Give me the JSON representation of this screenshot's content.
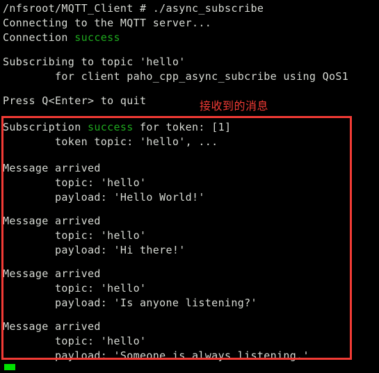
{
  "terminal": {
    "background_color": "#000000",
    "foreground_color": "#d8dbd5",
    "success_color": "#1faa1f",
    "cursor_color": "#00e000",
    "lines": [
      {
        "indent": 0,
        "text": "/nfsroot/MQTT_Client # ./async_subscribe"
      },
      {
        "indent": 0,
        "text": "Connecting to the MQTT server..."
      },
      {
        "indent": 0,
        "text": "Connection "
      },
      {
        "indent": 0,
        "text": ""
      },
      {
        "indent": 0,
        "text": "Subscribing to topic 'hello'"
      },
      {
        "indent": 8,
        "text": "for client paho_cpp_async_subcribe using QoS1"
      },
      {
        "indent": 0,
        "text": ""
      },
      {
        "indent": 0,
        "text": "Press Q<Enter> to quit"
      },
      {
        "indent": 0,
        "text": ""
      },
      {
        "indent": 0,
        "text": "Subscription "
      },
      {
        "indent": 8,
        "text": "token topic: 'hello', ..."
      },
      {
        "indent": 0,
        "text": ""
      },
      {
        "indent": 0,
        "text": "Message arrived"
      },
      {
        "indent": 8,
        "text": "topic: 'hello'"
      },
      {
        "indent": 8,
        "text": "payload: 'Hello World!'"
      },
      {
        "indent": 0,
        "text": ""
      },
      {
        "indent": 0,
        "text": "Message arrived"
      },
      {
        "indent": 8,
        "text": "topic: 'hello'"
      },
      {
        "indent": 8,
        "text": "payload: 'Hi there!'"
      },
      {
        "indent": 0,
        "text": ""
      },
      {
        "indent": 0,
        "text": "Message arrived"
      },
      {
        "indent": 8,
        "text": "topic: 'hello'"
      },
      {
        "indent": 8,
        "text": "payload: 'Is anyone listening?'"
      },
      {
        "indent": 0,
        "text": ""
      },
      {
        "indent": 0,
        "text": "Message arrived"
      },
      {
        "indent": 8,
        "text": "topic: 'hello'"
      },
      {
        "indent": 8,
        "text": "payload: 'Someone is always listening.'"
      }
    ],
    "line_prompt": "/nfsroot/MQTT_Client # ./async_subscribe",
    "line_connecting": "Connecting to the MQTT server...",
    "line_connection_prefix": "Connection ",
    "line_connection_status": "success",
    "line_subscribing": "Subscribing to topic 'hello'",
    "line_subscribing_client": "        for client paho_cpp_async_subcribe using QoS1",
    "line_press_quit": "Press Q<Enter> to quit",
    "line_subscription_prefix": "Subscription ",
    "line_subscription_status": "success",
    "line_subscription_suffix": " for token: [1]",
    "line_token_topic": "        token topic: 'hello', ...",
    "msg1_header": "Message arrived",
    "msg1_topic": "        topic: 'hello'",
    "msg1_payload": "        payload: 'Hello World!'",
    "msg2_header": "Message arrived",
    "msg2_topic": "        topic: 'hello'",
    "msg2_payload": "        payload: 'Hi there!'",
    "msg3_header": "Message arrived",
    "msg3_topic": "        topic: 'hello'",
    "msg3_payload": "        payload: 'Is anyone listening?'",
    "msg4_header": "Message arrived",
    "msg4_topic": "        topic: 'hello'",
    "msg4_payload": "        payload: 'Someone is always listening.'"
  },
  "annotation": {
    "label": "接收到的消息",
    "color": "#f23b35",
    "box_color": "#f23b35"
  }
}
